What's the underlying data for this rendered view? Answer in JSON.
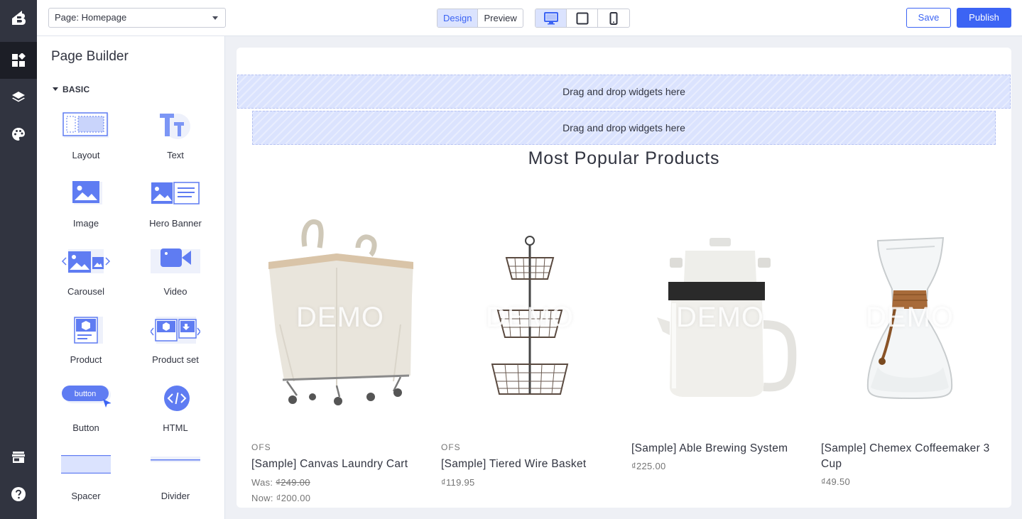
{
  "topbar": {
    "page_select": "Page: Homepage",
    "modes": [
      "Design",
      "Preview"
    ],
    "active_mode": "Design",
    "devices": [
      "desktop-icon",
      "tablet-icon",
      "mobile-icon"
    ],
    "active_device": "desktop",
    "save_label": "Save",
    "publish_label": "Publish"
  },
  "rail": {
    "items": [
      "widgets-icon",
      "layers-icon",
      "palette-icon",
      "storefront-icon",
      "help-icon"
    ]
  },
  "panel": {
    "title": "Page Builder",
    "section": "BASIC",
    "widgets": [
      {
        "label": "Layout",
        "icon": "layout-icon"
      },
      {
        "label": "Text",
        "icon": "text-icon"
      },
      {
        "label": "Image",
        "icon": "image-icon"
      },
      {
        "label": "Hero Banner",
        "icon": "hero-banner-icon"
      },
      {
        "label": "Carousel",
        "icon": "carousel-icon"
      },
      {
        "label": "Video",
        "icon": "video-icon"
      },
      {
        "label": "Product",
        "icon": "product-icon"
      },
      {
        "label": "Product set",
        "icon": "product-set-icon"
      },
      {
        "label": "Button",
        "icon": "button-icon",
        "icon_text": "button"
      },
      {
        "label": "HTML",
        "icon": "html-icon"
      },
      {
        "label": "Spacer",
        "icon": "spacer-icon"
      },
      {
        "label": "Divider",
        "icon": "divider-icon"
      }
    ]
  },
  "canvas": {
    "drop_text_1": "Drag and drop widgets here",
    "drop_text_2": "Drag and drop widgets here",
    "section_title": "Most Popular Products",
    "products": [
      {
        "brand": "OFS",
        "name": "[Sample] Canvas Laundry Cart",
        "was_label": "Was:",
        "was_price": "₫249.00",
        "now_label": "Now:",
        "now_price": "₫200.00",
        "watermark": "DEMO"
      },
      {
        "brand": "OFS",
        "name": "[Sample] Tiered Wire Basket",
        "price": "₫119.95",
        "watermark": "DEMO"
      },
      {
        "brand": "",
        "name": "[Sample] Able Brewing System",
        "price": "₫225.00",
        "watermark": "DEMO"
      },
      {
        "brand": "",
        "name": "[Sample] Chemex Coffeemaker 3 Cup",
        "price": "₫49.50",
        "watermark": "DEMO"
      }
    ]
  },
  "colors": {
    "accent": "#3c64f4",
    "rail": "#313440",
    "drop_zone": "#dbe3fe",
    "widget_icon": "#5f7cf2"
  }
}
